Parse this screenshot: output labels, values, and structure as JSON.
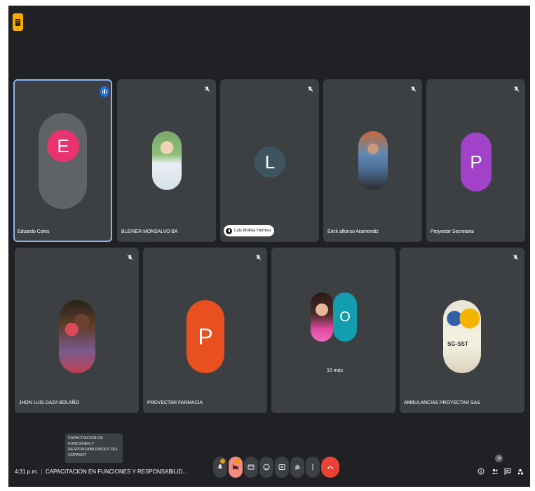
{
  "tiles_row1": [
    {
      "name": "Eduardo Cotes",
      "initial": "E",
      "color": "#e8336d",
      "speaking": true
    },
    {
      "name": "BLEINER MONSALVO BA",
      "initial": "",
      "color": "#6aa16a"
    },
    {
      "name": "Luis Molina Herrera",
      "initial": "L",
      "color": "#3e5560"
    },
    {
      "name": "Erick alfonso Aramendiz",
      "initial": "",
      "color": "#4a6f8f"
    },
    {
      "name": "Proyectar Secretaria",
      "initial": "P",
      "color": "#a142c9"
    }
  ],
  "tiles_row2": [
    {
      "name": "JHON LUIS DAZA BOLAÑO",
      "initial": "",
      "color": "#8b5a3c"
    },
    {
      "name": "PROYECTAR FARMACIA",
      "initial": "P",
      "color": "#e8501f"
    },
    {
      "name": "",
      "initial": "O",
      "color": "#129eaf",
      "more": "10 más"
    },
    {
      "name": "AMBULANCIAS PROYECTAR SAS",
      "initial": "",
      "color": "#f4f1e3",
      "logo_text": "SG-SST"
    }
  ],
  "bottom": {
    "time": "4:31 p.m.",
    "separator": "|",
    "meeting_title": "CAPACITACION EN FUNCIONES Y RESPONSABILID...",
    "tooltip": "CAPACITACION EN FUNCIONES Y RESPONSABILIDADES DEL COPASST",
    "participant_count": "18"
  },
  "icons": {
    "mic": "mic-icon",
    "camera": "camera-off-icon",
    "captions": "captions-icon",
    "emoji": "emoji-icon",
    "present": "present-icon",
    "raise_hand": "raise-hand-icon",
    "more": "more-options-icon",
    "leave": "leave-call-icon",
    "info": "info-icon",
    "people": "people-icon",
    "chat": "chat-icon",
    "activities": "activities-icon"
  },
  "colors": {
    "background": "#202124",
    "tile": "#3c4043",
    "active_outline": "#8ab4f8",
    "leave": "#ea4335",
    "alert": "#f29900"
  }
}
